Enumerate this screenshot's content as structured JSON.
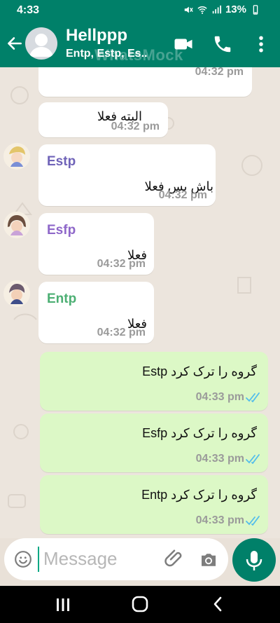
{
  "status": {
    "time": "4:33",
    "battery": "13%"
  },
  "header": {
    "title": "Hellppp",
    "subtitle": "Entp, Estp, Es..",
    "watermark": "WhatsMock"
  },
  "messages": [
    {
      "type": "incoming",
      "time": "04:32 pm"
    },
    {
      "type": "incoming",
      "text": "البته فعلا",
      "time": "04:32 pm"
    },
    {
      "type": "incoming",
      "sender": "Estp",
      "sender_color": "#6f63b8",
      "text": "باش بس فعلا",
      "time": "04:32 pm"
    },
    {
      "type": "incoming",
      "sender": "Esfp",
      "sender_color": "#8e67c9",
      "text": "فعلا",
      "time": "04:32 pm"
    },
    {
      "type": "incoming",
      "sender": "Entp",
      "sender_color": "#4caf73",
      "text": "فعلا",
      "time": "04:32 pm"
    },
    {
      "type": "outgoing",
      "text": "گروه را ترک کرد Estp",
      "time": "04:33 pm"
    },
    {
      "type": "outgoing",
      "text": "گروه را ترک کرد Esfp",
      "time": "04:33 pm"
    },
    {
      "type": "outgoing",
      "text": "گروه را ترک کرد Entp",
      "time": "04:33 pm"
    }
  ],
  "composer": {
    "placeholder": "Message"
  },
  "icons": {
    "back": "arrow-left-icon",
    "video": "video-camera-icon",
    "call": "phone-icon",
    "menu": "more-vertical-icon",
    "emoji": "emoji-icon",
    "attach": "paperclip-icon",
    "camera": "camera-icon",
    "mic": "microphone-icon",
    "nav_recent": "recent-apps-icon",
    "nav_home": "home-icon",
    "nav_back": "back-icon"
  },
  "colors": {
    "brand": "#008069",
    "outgoing_bubble": "#dcf8c6",
    "incoming_bubble": "#ffffff",
    "read_tick": "#53bdeb"
  }
}
